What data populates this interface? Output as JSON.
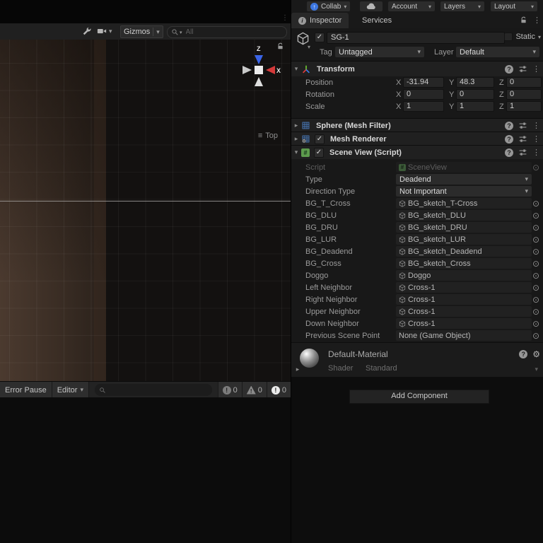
{
  "icons": {
    "check": "✓",
    "dropdown": "▾",
    "foldout_open": "▾",
    "foldout_closed": "▸",
    "menu": "⋮",
    "picker": "⊙",
    "help": "?",
    "info": "i",
    "script_hash": "#",
    "exclaim": "!",
    "gear": "⚙",
    "hamburger": "≡",
    "up_arrow": "↑"
  },
  "colors": {
    "accent_blue": "#3d77e0",
    "axis_x_red": "#d53a3a",
    "axis_z_blue": "#3a64e8",
    "mesh_icon_blue": "#4b7fc4",
    "script_icon_green": "#5d9b4d"
  },
  "topbar": {
    "collab": "Collab",
    "account": "Account",
    "layers": "Layers",
    "layout": "Layout"
  },
  "tabs": {
    "inspector": "Inspector",
    "services": "Services"
  },
  "gameobject": {
    "name": "SG-1",
    "static": "Static",
    "tag_label": "Tag",
    "tag": "Untagged",
    "layer_label": "Layer",
    "layer": "Default"
  },
  "transform": {
    "title": "Transform",
    "axes": [
      "X",
      "Y",
      "Z"
    ],
    "rows": [
      {
        "label": "Position",
        "x": "-31.94",
        "y": "48.3",
        "z": "0"
      },
      {
        "label": "Rotation",
        "x": "0",
        "y": "0",
        "z": "0"
      },
      {
        "label": "Scale",
        "x": "1",
        "y": "1",
        "z": "1"
      }
    ]
  },
  "components": {
    "mesh_filter": "Sphere (Mesh Filter)",
    "mesh_renderer": "Mesh Renderer",
    "scene_view": "Scene View (Script)"
  },
  "script": {
    "rows": [
      {
        "label": "Script",
        "value": "SceneView"
      },
      {
        "label": "Type",
        "value": "Deadend"
      },
      {
        "label": "Direction Type",
        "value": "Not Important"
      },
      {
        "label": "BG_T_Cross",
        "value": "BG_sketch_T-Cross"
      },
      {
        "label": "BG_DLU",
        "value": "BG_sketch_DLU"
      },
      {
        "label": "BG_DRU",
        "value": "BG_sketch_DRU"
      },
      {
        "label": "BG_LUR",
        "value": "BG_sketch_LUR"
      },
      {
        "label": "BG_Deadend",
        "value": "BG_sketch_Deadend"
      },
      {
        "label": "BG_Cross",
        "value": "BG_sketch_Cross"
      },
      {
        "label": "Doggo",
        "value": "Doggo"
      },
      {
        "label": "Left Neighbor",
        "value": "Cross-1"
      },
      {
        "label": "Right Neighbor",
        "value": "Cross-1"
      },
      {
        "label": "Upper Neighbor",
        "value": "Cross-1"
      },
      {
        "label": "Down Neighbor",
        "value": "Cross-1"
      },
      {
        "label": "Previous Scene Point",
        "value": "None (Game Object)"
      }
    ]
  },
  "material": {
    "name": "Default-Material",
    "shader_label": "Shader",
    "shader": "Standard"
  },
  "add_component": "Add Component",
  "scene": {
    "gizmos": "Gizmos",
    "search_placeholder": "All",
    "view_mode": "Top",
    "axis_x": "X",
    "axis_z": "Z"
  },
  "console": {
    "error_pause": "Error Pause",
    "editor": "Editor",
    "info_count": "0",
    "warning_count": "0",
    "error_count": "0"
  }
}
